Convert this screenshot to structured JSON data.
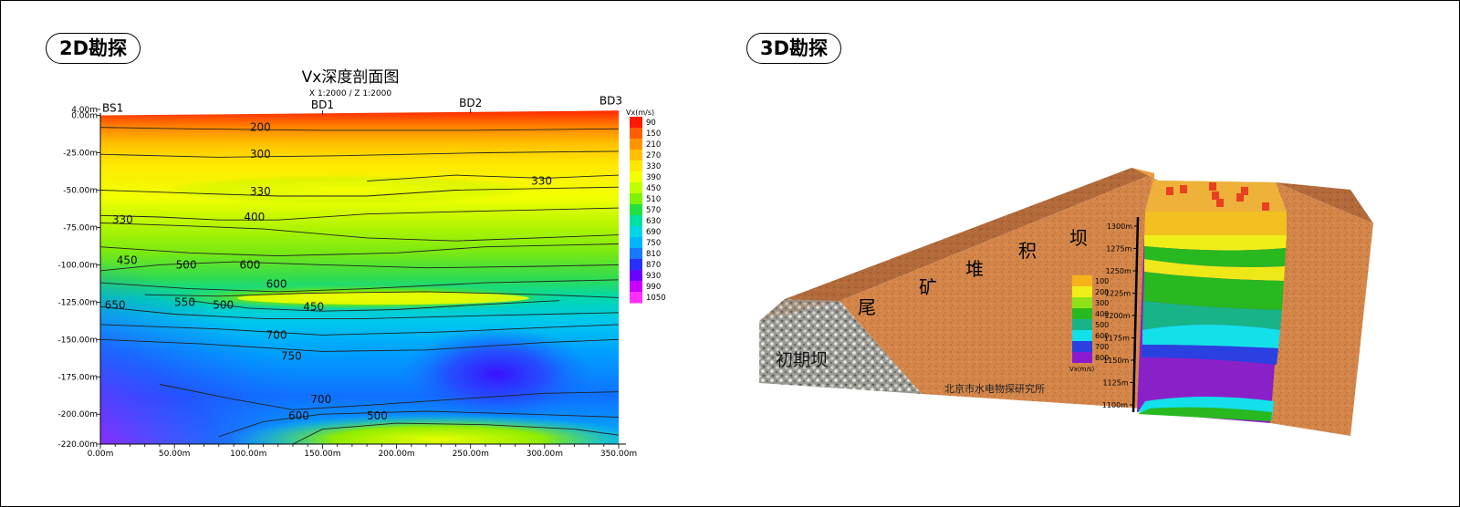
{
  "labels": {
    "left_tag": "2D勘探",
    "right_tag": "3D勘探"
  },
  "chart_data": [
    {
      "type": "heatmap",
      "title": "Vx深度剖面图",
      "subtitle": "X 1:2000 / Z 1:2000",
      "x_ticks": [
        "0.00m",
        "50.00m",
        "100.00m",
        "150.00m",
        "200.00m",
        "250.00m",
        "300.00m",
        "350.00m"
      ],
      "y_ticks": [
        "4.00m",
        "0.00m",
        "-25.00m",
        "-50.00m",
        "-75.00m",
        "-100.00m",
        "-125.00m",
        "-150.00m",
        "-175.00m",
        "-200.00m",
        "-220.00m"
      ],
      "xlim": [
        0,
        350
      ],
      "ylim": [
        -220,
        4
      ],
      "stations": [
        {
          "name": "BS1",
          "x": 0
        },
        {
          "name": "BD1",
          "x": 150
        },
        {
          "name": "BD2",
          "x": 250
        },
        {
          "name": "BD3",
          "x": 350
        }
      ],
      "colorbar_title": "Vx(m/s)",
      "colorbar_ticks": [
        "90",
        "150",
        "210",
        "270",
        "330",
        "390",
        "450",
        "510",
        "570",
        "630",
        "690",
        "750",
        "810",
        "870",
        "930",
        "990",
        "1050"
      ],
      "colorbar_colors": [
        "#ff1a00",
        "#ff5e00",
        "#ff9400",
        "#ffc000",
        "#ffe600",
        "#f2ff00",
        "#c0ff00",
        "#7cf200",
        "#22e040",
        "#00e0a0",
        "#00d6e8",
        "#00b4ff",
        "#1878ff",
        "#2830ff",
        "#6a00ff",
        "#c800ff",
        "#ff30ff"
      ],
      "contour_labels": [
        {
          "text": "200",
          "x": 108,
          "y": -8
        },
        {
          "text": "300",
          "x": 108,
          "y": -26
        },
        {
          "text": "330",
          "x": 108,
          "y": -51
        },
        {
          "text": "330",
          "x": 298,
          "y": -44
        },
        {
          "text": "330",
          "x": 15,
          "y": -70
        },
        {
          "text": "400",
          "x": 104,
          "y": -68
        },
        {
          "text": "450",
          "x": 18,
          "y": -97
        },
        {
          "text": "500",
          "x": 58,
          "y": -100
        },
        {
          "text": "600",
          "x": 101,
          "y": -100
        },
        {
          "text": "600",
          "x": 119,
          "y": -113
        },
        {
          "text": "650",
          "x": 10,
          "y": -127
        },
        {
          "text": "550",
          "x": 57,
          "y": -125
        },
        {
          "text": "500",
          "x": 83,
          "y": -127
        },
        {
          "text": "450",
          "x": 144,
          "y": -128
        },
        {
          "text": "700",
          "x": 119,
          "y": -147
        },
        {
          "text": "750",
          "x": 129,
          "y": -161
        },
        {
          "text": "700",
          "x": 149,
          "y": -190
        },
        {
          "text": "600",
          "x": 134,
          "y": -201
        },
        {
          "text": "500",
          "x": 187,
          "y": -201
        }
      ]
    },
    {
      "type": "other",
      "dam_labels": [
        "尾",
        "矿",
        "堆",
        "积",
        "坝"
      ],
      "starter_dam_label": "初期坝",
      "institute": "北京市水电物探研究所",
      "legend_title": "Vx(m/s)",
      "legend_values": [
        "100",
        "200",
        "300",
        "400",
        "500",
        "600",
        "700",
        "800"
      ],
      "legend_colors": [
        "#f7b21a",
        "#f0ee1a",
        "#8ee21a",
        "#28b820",
        "#18b488",
        "#12e0ea",
        "#2a40e0",
        "#8a1ad0"
      ],
      "depth_ticks": [
        "1300m",
        "1275m",
        "1250m",
        "1225m",
        "1200m",
        "1175m",
        "1150m",
        "1125m",
        "1100m"
      ]
    }
  ]
}
